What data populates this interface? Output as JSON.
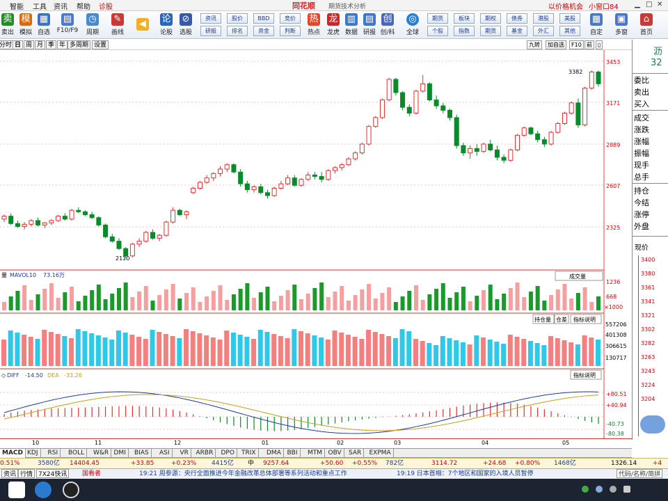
{
  "menu": {
    "items": [
      "智能",
      "工具",
      "资讯",
      "帮助",
      "诊股"
    ],
    "brand": "同花顺",
    "appname": "期货技术分析",
    "right": [
      "以价格机会",
      "小窗口84"
    ]
  },
  "toolbar": {
    "buttons": [
      {
        "label": "卖出",
        "icon": "sell-icon",
        "color": "#2a8a2a"
      },
      {
        "label": "模拟",
        "icon": "simulate-icon",
        "color": "#d86a10"
      },
      {
        "label": "自选",
        "icon": "watchlist-icon",
        "color": "#3a72c8"
      },
      {
        "label": "F10/F9",
        "icon": "f10-icon",
        "color": "#4a7ad0"
      },
      {
        "label": "周期",
        "icon": "clock-icon",
        "color": "#4a8ad0"
      },
      {
        "label": "画线",
        "icon": "pen-icon",
        "color": "#c83a3a"
      },
      {
        "label": "",
        "icon": "back-arrow-icon",
        "color": "#f0b020"
      },
      {
        "label": "论股",
        "icon": "discuss-icon",
        "color": "#2a66b8"
      },
      {
        "label": "选股",
        "icon": "select-stock-icon",
        "color": "#3a58a8"
      }
    ],
    "small": [
      {
        "top": "资讯",
        "bottom": "研报"
      },
      {
        "top": "股价",
        "bottom": "排名"
      },
      {
        "top": "BBD",
        "bottom": "资金"
      },
      {
        "top": "竞价",
        "bottom": "判断"
      }
    ],
    "buttons2": [
      {
        "label": "热点",
        "icon": "hot-icon",
        "color": "#e04a2a"
      },
      {
        "label": "龙虎",
        "icon": "dragon-icon",
        "color": "#c82a2a"
      },
      {
        "label": "数据",
        "icon": "data-icon",
        "color": "#3a78c8"
      },
      {
        "label": "研报",
        "icon": "report-icon",
        "color": "#3a78c8"
      },
      {
        "label": "创/科",
        "icon": "board-icon",
        "color": "#4a68b8"
      },
      {
        "label": "全球",
        "icon": "globe-icon",
        "color": "#2a80d0"
      }
    ],
    "small2": [
      {
        "top": "期货",
        "bottom": "个股"
      },
      {
        "top": "板块",
        "bottom": "指数"
      },
      {
        "top": "期权",
        "bottom": "期货"
      },
      {
        "top": "债券",
        "bottom": "基金"
      },
      {
        "top": "港股",
        "bottom": "外汇"
      },
      {
        "top": "美股",
        "bottom": "其他"
      }
    ],
    "buttons3": [
      {
        "label": "自定",
        "icon": "custom-icon",
        "color": "#4a78c8"
      },
      {
        "label": "多窗",
        "icon": "multiwindow-icon",
        "color": "#4a78c8"
      },
      {
        "label": "首页",
        "icon": "home-icon",
        "color": "#c83a3a"
      }
    ]
  },
  "periods": [
    "分时",
    "日",
    "周",
    "月",
    "季",
    "年",
    "多周期",
    "设置"
  ],
  "right_tabs": [
    "九转",
    "加自选",
    "F10",
    "前"
  ],
  "main_chart": {
    "y_ticks": [
      "3453",
      "3171",
      "2889",
      "2607",
      "2325"
    ],
    "high_label": "3382",
    "low_label": "2110",
    "candles": [
      [
        2380,
        2410,
        2360,
        2400
      ],
      [
        2400,
        2420,
        2340,
        2350
      ],
      [
        2350,
        2370,
        2320,
        2330
      ],
      [
        2330,
        2360,
        2310,
        2345
      ],
      [
        2345,
        2380,
        2330,
        2370
      ],
      [
        2370,
        2390,
        2330,
        2340
      ],
      [
        2340,
        2360,
        2320,
        2355
      ],
      [
        2355,
        2380,
        2340,
        2370
      ],
      [
        2370,
        2410,
        2360,
        2400
      ],
      [
        2400,
        2420,
        2370,
        2380
      ],
      [
        2380,
        2450,
        2370,
        2440
      ],
      [
        2440,
        2460,
        2420,
        2430
      ],
      [
        2430,
        2440,
        2400,
        2410
      ],
      [
        2410,
        2430,
        2380,
        2390
      ],
      [
        2390,
        2400,
        2330,
        2340
      ],
      [
        2340,
        2350,
        2250,
        2260
      ],
      [
        2260,
        2280,
        2220,
        2230
      ],
      [
        2230,
        2250,
        2170,
        2180
      ],
      [
        2180,
        2190,
        2110,
        2130
      ],
      [
        2130,
        2220,
        2120,
        2210
      ],
      [
        2210,
        2250,
        2190,
        2230
      ],
      [
        2230,
        2300,
        2220,
        2290
      ],
      [
        2290,
        2310,
        2240,
        2250
      ],
      [
        2250,
        2280,
        2230,
        2270
      ],
      [
        2270,
        2370,
        2260,
        2360
      ],
      [
        2360,
        2460,
        2350,
        2440
      ],
      [
        2440,
        2450,
        2400,
        2410
      ],
      [
        2410,
        2440,
        2380,
        2430
      ],
      [
        2560,
        2600,
        2550,
        2590
      ],
      [
        2590,
        2640,
        2580,
        2630
      ],
      [
        2630,
        2680,
        2620,
        2660
      ],
      [
        2660,
        2700,
        2640,
        2690
      ],
      [
        2690,
        2740,
        2670,
        2720
      ],
      [
        2720,
        2760,
        2700,
        2750
      ],
      [
        2750,
        2760,
        2690,
        2700
      ],
      [
        2700,
        2720,
        2600,
        2620
      ],
      [
        2620,
        2640,
        2560,
        2580
      ],
      [
        2580,
        2610,
        2560,
        2600
      ],
      [
        2600,
        2620,
        2550,
        2560
      ],
      [
        2560,
        2580,
        2520,
        2540
      ],
      [
        2540,
        2600,
        2530,
        2590
      ],
      [
        2590,
        2640,
        2580,
        2620
      ],
      [
        2620,
        2680,
        2610,
        2660
      ],
      [
        2660,
        2680,
        2600,
        2610
      ],
      [
        2610,
        2660,
        2600,
        2650
      ],
      [
        2650,
        2700,
        2640,
        2680
      ],
      [
        2680,
        2700,
        2650,
        2670
      ],
      [
        2670,
        2700,
        2630,
        2650
      ],
      [
        2650,
        2720,
        2640,
        2710
      ],
      [
        2710,
        2740,
        2690,
        2730
      ],
      [
        2730,
        2760,
        2710,
        2750
      ],
      [
        2750,
        2800,
        2740,
        2790
      ],
      [
        2790,
        2840,
        2780,
        2830
      ],
      [
        2830,
        2900,
        2820,
        2890
      ],
      [
        2890,
        3020,
        2880,
        3010
      ],
      [
        3010,
        3080,
        3000,
        3070
      ],
      [
        3070,
        3200,
        3060,
        3190
      ],
      [
        3190,
        3340,
        3180,
        3330
      ],
      [
        3330,
        3340,
        3220,
        3240
      ],
      [
        3240,
        3250,
        3120,
        3140
      ],
      [
        3140,
        3160,
        3080,
        3100
      ],
      [
        3100,
        3260,
        3090,
        3250
      ],
      [
        3250,
        3360,
        3240,
        3300
      ],
      [
        3300,
        3310,
        3180,
        3190
      ],
      [
        3190,
        3220,
        3130,
        3150
      ],
      [
        3150,
        3170,
        3100,
        3120
      ],
      [
        3120,
        3130,
        3050,
        3070
      ],
      [
        3070,
        3090,
        2860,
        2880
      ],
      [
        2880,
        2900,
        2810,
        2830
      ],
      [
        2830,
        2880,
        2790,
        2860
      ],
      [
        2860,
        2890,
        2810,
        2840
      ],
      [
        2840,
        2900,
        2830,
        2890
      ],
      [
        2890,
        2920,
        2840,
        2850
      ],
      [
        2850,
        2880,
        2780,
        2800
      ],
      [
        2800,
        2820,
        2760,
        2780
      ],
      [
        2780,
        2860,
        2770,
        2850
      ],
      [
        2850,
        2960,
        2840,
        2950
      ],
      [
        2950,
        3010,
        2940,
        3000
      ],
      [
        3000,
        3010,
        2950,
        2960
      ],
      [
        2960,
        2980,
        2900,
        2920
      ],
      [
        2920,
        2940,
        2870,
        2890
      ],
      [
        2890,
        2980,
        2880,
        2970
      ],
      [
        2970,
        3040,
        2960,
        3030
      ],
      [
        3030,
        3110,
        3020,
        3100
      ],
      [
        3100,
        3180,
        3090,
        3170
      ],
      [
        3170,
        3200,
        3000,
        3020
      ],
      [
        3020,
        3280,
        3010,
        3270
      ],
      [
        3270,
        3390,
        3260,
        3380
      ],
      [
        3380,
        3390,
        3280,
        3300
      ]
    ]
  },
  "volume": {
    "label": "MAVOL10",
    "value": "73.16万",
    "y_ticks": [
      "1236",
      "668",
      "×1000"
    ],
    "dropdown": "成交量"
  },
  "oi": {
    "y_ticks": [
      "557206",
      "401308",
      "306615",
      "130717"
    ],
    "tabs": [
      "持仓量",
      "仓差",
      "指标说明"
    ]
  },
  "macd": {
    "diff_label": "DIFF",
    "diff_value": "-14.50",
    "dea_label": "DEA",
    "dea_value": "-33.26",
    "y_ticks": [
      "+80.51",
      "+40.94",
      "-40.73",
      "-80.38"
    ],
    "tab": "指标说明"
  },
  "x_axis": [
    "10",
    "11",
    "12",
    "01",
    "02",
    "03",
    "04",
    "05"
  ],
  "right_panel": {
    "code": "沥",
    "price": "32",
    "labels": [
      "委比",
      "卖出",
      "买入",
      "成交",
      "涨跌",
      "涨幅",
      "振幅",
      "现手",
      "总手",
      "持仓",
      "今结",
      "涨停",
      "外盘"
    ],
    "price_label": "现价",
    "mini_ticks": [
      "3400",
      "3380",
      "3361",
      "3341",
      "3321",
      "3302",
      "3282",
      "3263",
      "3243",
      "3224",
      "3204"
    ]
  },
  "indicators": [
    "MACD",
    "KDJ",
    "RSI",
    "BOLL",
    "W&R",
    "DMI",
    "BIAS",
    "ASI",
    "VR",
    "ARBR",
    "DPO",
    "TRIX",
    "DMA",
    "BBI",
    "MTM",
    "OBV",
    "SAR",
    "EXPMA"
  ],
  "ticker": [
    {
      "text": "0.51%",
      "color": "#d00000"
    },
    {
      "text": "3580亿",
      "color": "#1a3c9a"
    },
    {
      "text": "14404.45",
      "color": "#d00000"
    },
    {
      "text": "+33.85",
      "color": "#d00000"
    },
    {
      "text": "+0.23%",
      "color": "#d00000"
    },
    {
      "text": "4415亿",
      "color": "#1a3c9a"
    },
    {
      "text": "中",
      "color": "#000"
    },
    {
      "text": "9257.64",
      "color": "#d00000"
    },
    {
      "text": "+50.60",
      "color": "#d00000"
    },
    {
      "text": "+0.55%",
      "color": "#d00000"
    },
    {
      "text": "782亿",
      "color": "#1a3c9a"
    },
    {
      "text": "3114.72",
      "color": "#d00000"
    },
    {
      "text": "+24.68",
      "color": "#d00000"
    },
    {
      "text": "+0.80%",
      "color": "#d00000"
    },
    {
      "text": "1468亿",
      "color": "#1a3c9a"
    },
    {
      "text": "1326.14",
      "color": "#000"
    },
    {
      "text": "+4",
      "color": "#d00000"
    }
  ],
  "news": {
    "left_tabs": [
      "资讯",
      "行情",
      "7X24快讯"
    ],
    "title": "国看者",
    "item1": "19:21 周参源：央行全面推进今年金融改革总体部署等系列活动和重点工作",
    "item2": "19:19 日本首相：7个地区和国家的入境人员暂停",
    "right": "代码/名称/简拼"
  }
}
